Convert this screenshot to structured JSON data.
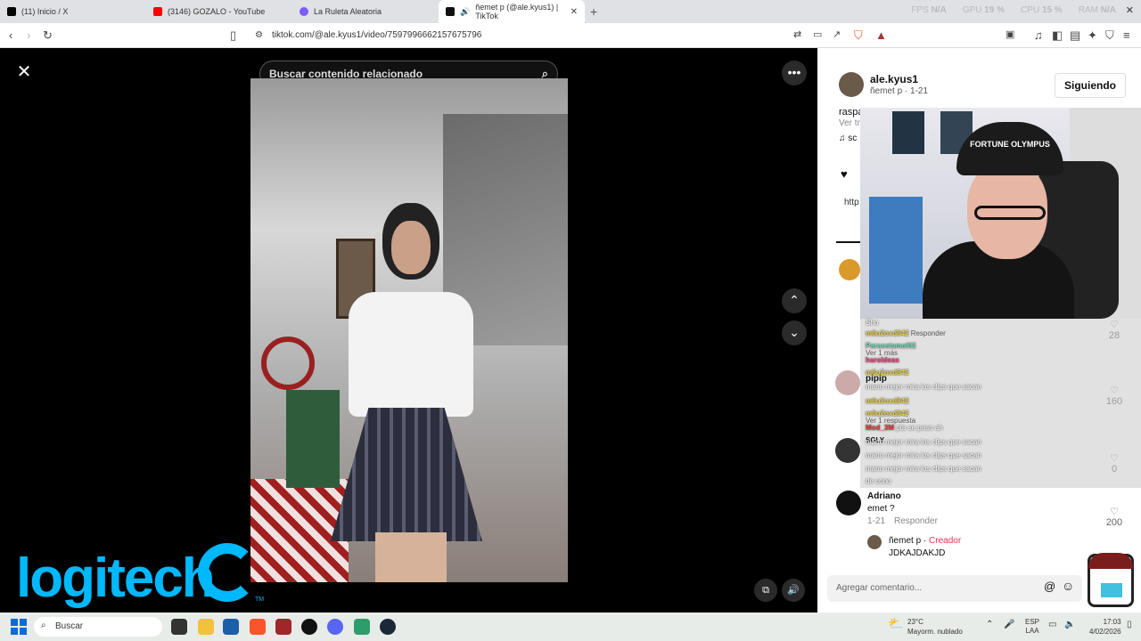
{
  "tabs": [
    {
      "label": "(11) Inicio / X",
      "color": "#000000"
    },
    {
      "label": "(3146) GOZALO - YouTube",
      "color": "#ff0000"
    },
    {
      "label": "La Ruleta Aleatoria",
      "color": "#7a5cff"
    },
    {
      "label": "ñemet p (@ale.kyus1) | TikTok",
      "color": "#111111"
    }
  ],
  "perf": {
    "fps_label": "FPS",
    "fps": "N/A",
    "gpu_label": "GPU",
    "gpu": "19 %",
    "cpu_label": "CPU",
    "cpu": "15 %",
    "ram_label": "RAM",
    "ram": "N/A"
  },
  "address": {
    "url": "tiktok.com/@ale.kyus1/video/7597996662157675796"
  },
  "video": {
    "search_placeholder": "Buscar contenido relacionado"
  },
  "author": {
    "username": "ale.kyus1",
    "display": "ñemet p · 1-21",
    "follow_label": "Siguiendo",
    "caption_partial": "raspa",
    "see_translation": "Ver tr",
    "link_partial": "http"
  },
  "overlay": {
    "cap_text": "FORTUNE OLYMPUS",
    "chat": [
      {
        "user": "",
        "msg": "Sho"
      },
      {
        "user": "m6u2oxd842",
        "msg": "Responder"
      },
      {
        "user": "Paracetamol62",
        "msg": ""
      },
      {
        "user": "haroldeas",
        "msg": ""
      },
      {
        "user": "m6u2oxd842",
        "msg": ""
      },
      {
        "user": "",
        "msg": "mano mejor mira los clips que sacan"
      },
      {
        "user": "m6u2oxd842",
        "msg": ""
      },
      {
        "user": "m6u2oxd842",
        "msg": ""
      },
      {
        "user": "Mod_3M",
        "msg": "pta se paso ah"
      },
      {
        "user": "",
        "msg": "mano mejor mira los clips que sacan"
      },
      {
        "user": "",
        "msg": "mano mejor mira los clips que sacan"
      },
      {
        "user": "",
        "msg": "mano mejor mira los clips que sacan"
      },
      {
        "user": "",
        "msg": "de cono"
      }
    ],
    "under_text": {
      "ver_mas": "Ver 1 más",
      "pipip": "pipip",
      "ver_respuesta": "Ver 1 respuesta",
      "sgly": "SGLY"
    }
  },
  "comments": [
    {
      "name": "Adriano",
      "text": "emet ?",
      "date": "1-21",
      "reply": "Responder",
      "likes": "200"
    },
    {
      "name": "ñemet p",
      "creator": "Creador",
      "text": "JDKAJDAKJD"
    }
  ],
  "likes_visible": [
    "28",
    "160",
    "0"
  ],
  "add_comment_placeholder": "Agregar comentario...",
  "logo_text": "logitech",
  "taskbar": {
    "search": "Buscar",
    "temp": "23°C",
    "weather": "Mayorm. nublado",
    "lang1": "ESP",
    "lang2": "LAA",
    "time": "17:03",
    "date": "4/02/2026"
  }
}
